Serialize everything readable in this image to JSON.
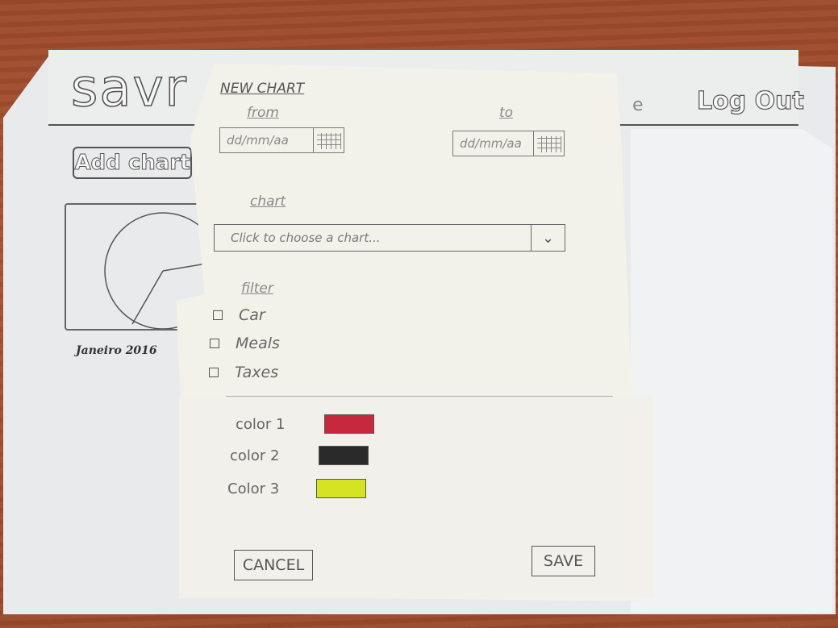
{
  "background_page": {
    "logo": "savr",
    "nav_partial": "e",
    "logout_label": "Log Out",
    "add_chart_label": "Add chart",
    "chart_caption": "Janeiro 2016"
  },
  "modal": {
    "title": "NEW CHART",
    "from_label": "from",
    "from_placeholder": "dd/mm/aa",
    "to_label": "to",
    "to_placeholder": "dd/mm/aa",
    "chart_label": "chart",
    "chart_placeholder": "Click to choose a chart...",
    "filter_label": "filter",
    "filters": [
      {
        "label": "Car",
        "checked": false
      },
      {
        "label": "Meals",
        "checked": false
      },
      {
        "label": "Taxes",
        "checked": false
      }
    ],
    "colors": [
      {
        "label": "color 1",
        "value": "#c8283c"
      },
      {
        "label": "color 2",
        "value": "#2a2a2a"
      },
      {
        "label": "Color 3",
        "value": "#d6e321"
      }
    ],
    "cancel_label": "CANCEL",
    "save_label": "SAVE"
  },
  "icons": {
    "calendar": "calendar-icon",
    "dropdown": "chevron-down-icon"
  }
}
